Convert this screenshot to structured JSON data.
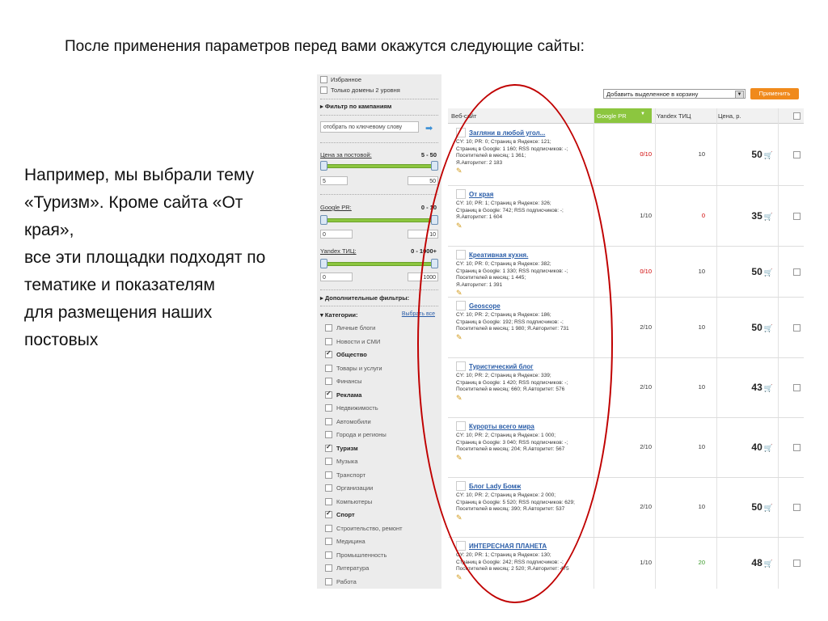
{
  "slide": {
    "title": "После применения параметров перед вами окажутся следующие сайты:",
    "body": "Например, мы выбрали тему «Туризм». Кроме сайта «От края»,\nвсе эти площадки подходят по тематике и показателям\nдля размещения наших постовых"
  },
  "sidebar": {
    "fav_label": "Избранное",
    "domains_label": "Только домены 2 уровня",
    "campaign_filter": "Фильтр по кампаниям",
    "keyword_placeholder": "отобрать по ключевому слову",
    "price": {
      "label": "Цена за постовой:",
      "range": "5 - 50",
      "min": "5",
      "max": "50"
    },
    "pr": {
      "label": "Google PR:",
      "range": "0 - 10",
      "min": "0",
      "max": "10"
    },
    "tic": {
      "label": "Yandex ТИЦ:",
      "range": "0 - 1000+",
      "min": "0",
      "max": "1000"
    },
    "extra_filters": "Дополнительные фильтры:",
    "categories_label": "Категории:",
    "select_all": "Выбрать все",
    "categories": [
      {
        "label": "Личные блоги",
        "checked": false
      },
      {
        "label": "Новости и СМИ",
        "checked": false
      },
      {
        "label": "Общество",
        "checked": true
      },
      {
        "label": "Товары и услуги",
        "checked": false
      },
      {
        "label": "Финансы",
        "checked": false
      },
      {
        "label": "Реклама",
        "checked": true
      },
      {
        "label": "Недвижимость",
        "checked": false
      },
      {
        "label": "Автомобили",
        "checked": false
      },
      {
        "label": "Города и регионы",
        "checked": false
      },
      {
        "label": "Туризм",
        "checked": true
      },
      {
        "label": "Музыка",
        "checked": false
      },
      {
        "label": "Транспорт",
        "checked": false
      },
      {
        "label": "Организации",
        "checked": false
      },
      {
        "label": "Компьютеры",
        "checked": false
      },
      {
        "label": "Спорт",
        "checked": true
      },
      {
        "label": "Строительство, ремонт",
        "checked": false
      },
      {
        "label": "Медицина",
        "checked": false
      },
      {
        "label": "Промышленность",
        "checked": false
      },
      {
        "label": "Литература",
        "checked": false
      },
      {
        "label": "Работа",
        "checked": false
      }
    ]
  },
  "toolbar": {
    "basket_select": "Добавить выделенное в корзину",
    "apply": "Применить"
  },
  "table": {
    "headers": {
      "site": "Веб-сайт",
      "pr": "Google PR",
      "tic": "Yandex ТИЦ",
      "price": "Цена, р."
    },
    "rows": [
      {
        "name": "Загляни в любой угол...",
        "lines": [
          "CY: 10; PR: 0; Страниц в Яндексе: 121;",
          "Страниц в Google: 1 160; RSS подписчиков: -;",
          "Посетителей в месяц: 1 361;",
          "Я.Авторитет: 2 183"
        ],
        "pr": "0/10",
        "tic": "10",
        "price": "50"
      },
      {
        "name": "От края",
        "lines": [
          "CY: 10; PR: 1; Страниц в Яндексе: 326;",
          "Страниц в Google: 742; RSS подписчиков: -;",
          "Я.Авторитет: 1 604"
        ],
        "pr": "1/10",
        "tic": "0",
        "price": "35"
      },
      {
        "name": "Креативная кухня.",
        "lines": [
          "CY: 10; PR: 0; Страниц в Яндексе: 382;",
          "Страниц в Google: 1 330; RSS подписчиков: -;",
          "Посетителей в месяц: 1 445;",
          "Я.Авторитет: 1 391"
        ],
        "pr": "0/10",
        "tic": "10",
        "price": "50"
      },
      {
        "name": "Geoscope",
        "lines": [
          "CY: 10; PR: 2; Страниц в Яндексе: 186;",
          "Страниц в Google: 192; RSS подписчиков: -;",
          "Посетителей в месяц: 1 980; Я.Авторитет: 731"
        ],
        "pr": "2/10",
        "tic": "10",
        "price": "50"
      },
      {
        "name": "Туристический блог",
        "lines": [
          "CY: 10; PR: 2; Страниц в Яндексе: 339;",
          "Страниц в Google: 1 420; RSS подписчиков: -;",
          "Посетителей в месяц: 660; Я.Авторитет: 576"
        ],
        "pr": "2/10",
        "tic": "10",
        "price": "43"
      },
      {
        "name": "Курорты всего мира",
        "lines": [
          "CY: 10; PR: 2; Страниц в Яндексе: 1 000;",
          "Страниц в Google: 3 040; RSS подписчиков: -;",
          "Посетителей в месяц: 204; Я.Авторитет: 567"
        ],
        "pr": "2/10",
        "tic": "10",
        "price": "40"
      },
      {
        "name": "Блог Lady Бомж",
        "lines": [
          "CY: 10; PR: 2; Страниц в Яндексе: 2 000;",
          "Страниц в Google: 5 520; RSS подписчиков: 629;",
          "Посетителей в месяц: 390; Я.Авторитет: 537"
        ],
        "pr": "2/10",
        "tic": "10",
        "price": "50"
      },
      {
        "name": "ИНТЕРЕСНАЯ ПЛАНЕТА",
        "lines": [
          "CY: 20; PR: 1; Страниц в Яндексе: 130;",
          "Страниц в Google: 242; RSS подписчиков: -;",
          "Посетителей в месяц: 2 520; Я.Авторитет: 475"
        ],
        "pr": "1/10",
        "tic": "20",
        "price": "48"
      }
    ]
  },
  "colors": {
    "accent_green": "#8cc63f",
    "apply_orange": "#f08a1c",
    "link_blue": "#2a5da8",
    "zero_red": "#d00000",
    "highlight_oval": "#c00000"
  }
}
